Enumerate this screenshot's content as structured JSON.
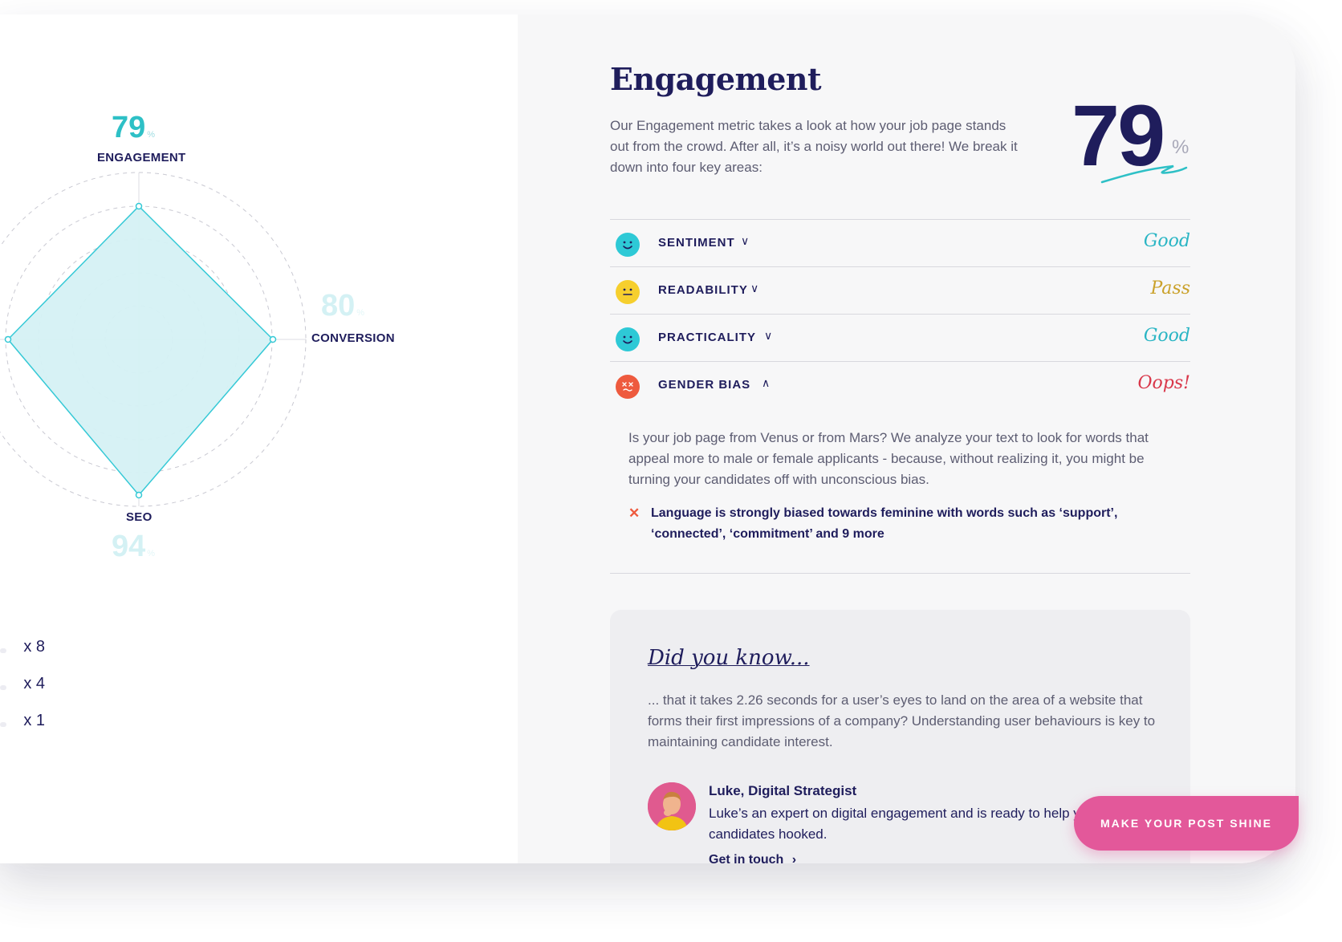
{
  "radar": {
    "engagement": {
      "value": "79",
      "unit": "%",
      "label": "ENGAGEMENT"
    },
    "conversion": {
      "value": "80",
      "unit": "%",
      "label": "CONVERSION"
    },
    "seo": {
      "value": "94",
      "unit": "%",
      "label": "SEO"
    },
    "accent_color": "#35c9d6"
  },
  "legend": [
    {
      "label": "x 8"
    },
    {
      "label": "x 4"
    },
    {
      "label": "x 1"
    }
  ],
  "section": {
    "title": "Engagement",
    "intro": "Our Engagement metric takes a look at how your job page stands out from the crowd. After all, it’s a noisy world out there! We break it down into four key areas:",
    "score": "79",
    "score_unit": "%"
  },
  "areas": [
    {
      "label": "SENTIMENT",
      "status": "Good",
      "icon": "happy-face-icon",
      "color": "#2ec9d6",
      "status_color": "#2ab5c4",
      "chevron": "∨"
    },
    {
      "label": "READABILITY",
      "status": "Pass",
      "icon": "neutral-face-icon",
      "color": "#f6cf2e",
      "status_color": "#caa12a",
      "chevron": "∨"
    },
    {
      "label": "PRACTICALITY",
      "status": "Good",
      "icon": "happy-face-icon",
      "color": "#2ec9d6",
      "status_color": "#2ab5c4",
      "chevron": "∨"
    },
    {
      "label": "GENDER BIAS",
      "status": "Oops!",
      "icon": "dizzy-face-icon",
      "color": "#ee5a3e",
      "status_color": "#d9374a",
      "chevron": "∧"
    }
  ],
  "gender_bias_detail": {
    "text": "Is your job page from Venus or from Mars? We analyze your text to look for words that appeal more to male or female applicants - because, without realizing it, you might be turning your candidates off with unconscious bias.",
    "finding": "Language is strongly biased towards feminine with words such as ‘support’, ‘connected’, ‘commitment’ and 9 more"
  },
  "did_you_know": {
    "title": "Did you know...",
    "text": "... that it takes 2.26 seconds for a user’s eyes to land on the area of a website that forms their first impressions of a company? Understanding user behaviours is key to maintaining candidate interest.",
    "person_name": "Luke, Digital Strategist",
    "person_desc": "Luke’s an expert on digital engagement and is ready to help y candidates hooked.",
    "contact": "Get in touch"
  },
  "cta": {
    "label": "MAKE YOUR POST SHINE"
  }
}
